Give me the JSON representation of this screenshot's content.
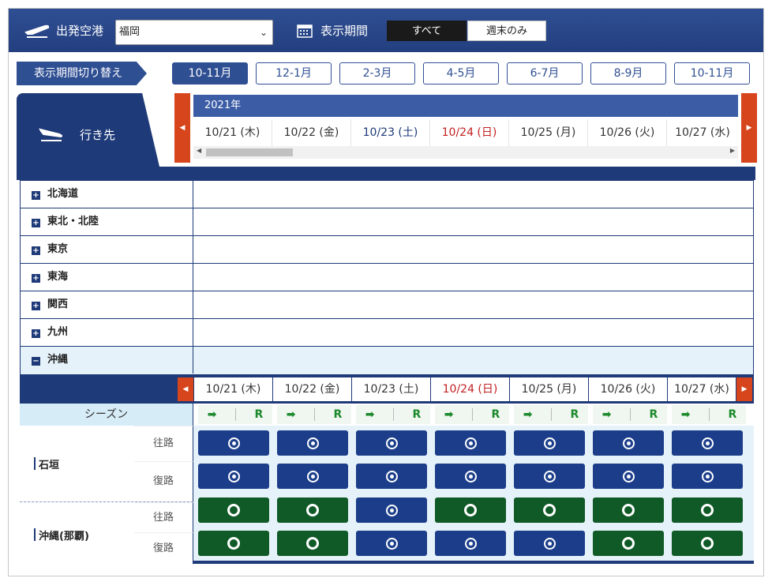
{
  "header": {
    "origin_label": "出発空港",
    "origin_value": "福岡",
    "period_label": "表示期間",
    "toggle_all": "すべて",
    "toggle_weekend": "週末のみ"
  },
  "period_switch": {
    "label": "表示期間切り替え",
    "buttons": [
      "10-11月",
      "12-1月",
      "2-3月",
      "4-5月",
      "6-7月",
      "8-9月",
      "10-11月"
    ],
    "active_index": 0
  },
  "destination_header": "行き先",
  "calendar": {
    "year": "2021年",
    "dates": [
      "10/21 (木)",
      "10/22 (金)",
      "10/23 (土)",
      "10/24 (日)",
      "10/25 (月)",
      "10/26 (火)",
      "10/27 (水)"
    ]
  },
  "regions": [
    {
      "name": "北海道",
      "expanded": false
    },
    {
      "name": "東北・北陸",
      "expanded": false
    },
    {
      "name": "東京",
      "expanded": false
    },
    {
      "name": "東海",
      "expanded": false
    },
    {
      "name": "関西",
      "expanded": false
    },
    {
      "name": "九州",
      "expanded": false
    },
    {
      "name": "沖縄",
      "expanded": true
    }
  ],
  "okinawa": {
    "season_label": "シーズン",
    "season_symbol_r": "R",
    "destinations": [
      {
        "name": "石垣",
        "outbound_label": "往路",
        "return_label": "復路",
        "outbound": [
          "blue",
          "blue",
          "blue",
          "blue",
          "blue",
          "blue",
          "blue"
        ],
        "return": [
          "blue",
          "blue",
          "blue",
          "blue",
          "blue",
          "blue",
          "blue"
        ]
      },
      {
        "name": "沖縄(那覇)",
        "outbound_label": "往路",
        "return_label": "復路",
        "outbound": [
          "green",
          "green",
          "blue",
          "green",
          "green",
          "green",
          "green"
        ],
        "return": [
          "green",
          "green",
          "blue",
          "blue",
          "blue",
          "green",
          "green"
        ]
      }
    ]
  },
  "colors": {
    "header_blue": "#2f4f93",
    "dark_navy": "#1e3a78",
    "available_blue": "#1c3e8a",
    "available_green": "#0f5a26",
    "sunday_red": "#c32020",
    "scroll_arrow": "#d6451b"
  }
}
